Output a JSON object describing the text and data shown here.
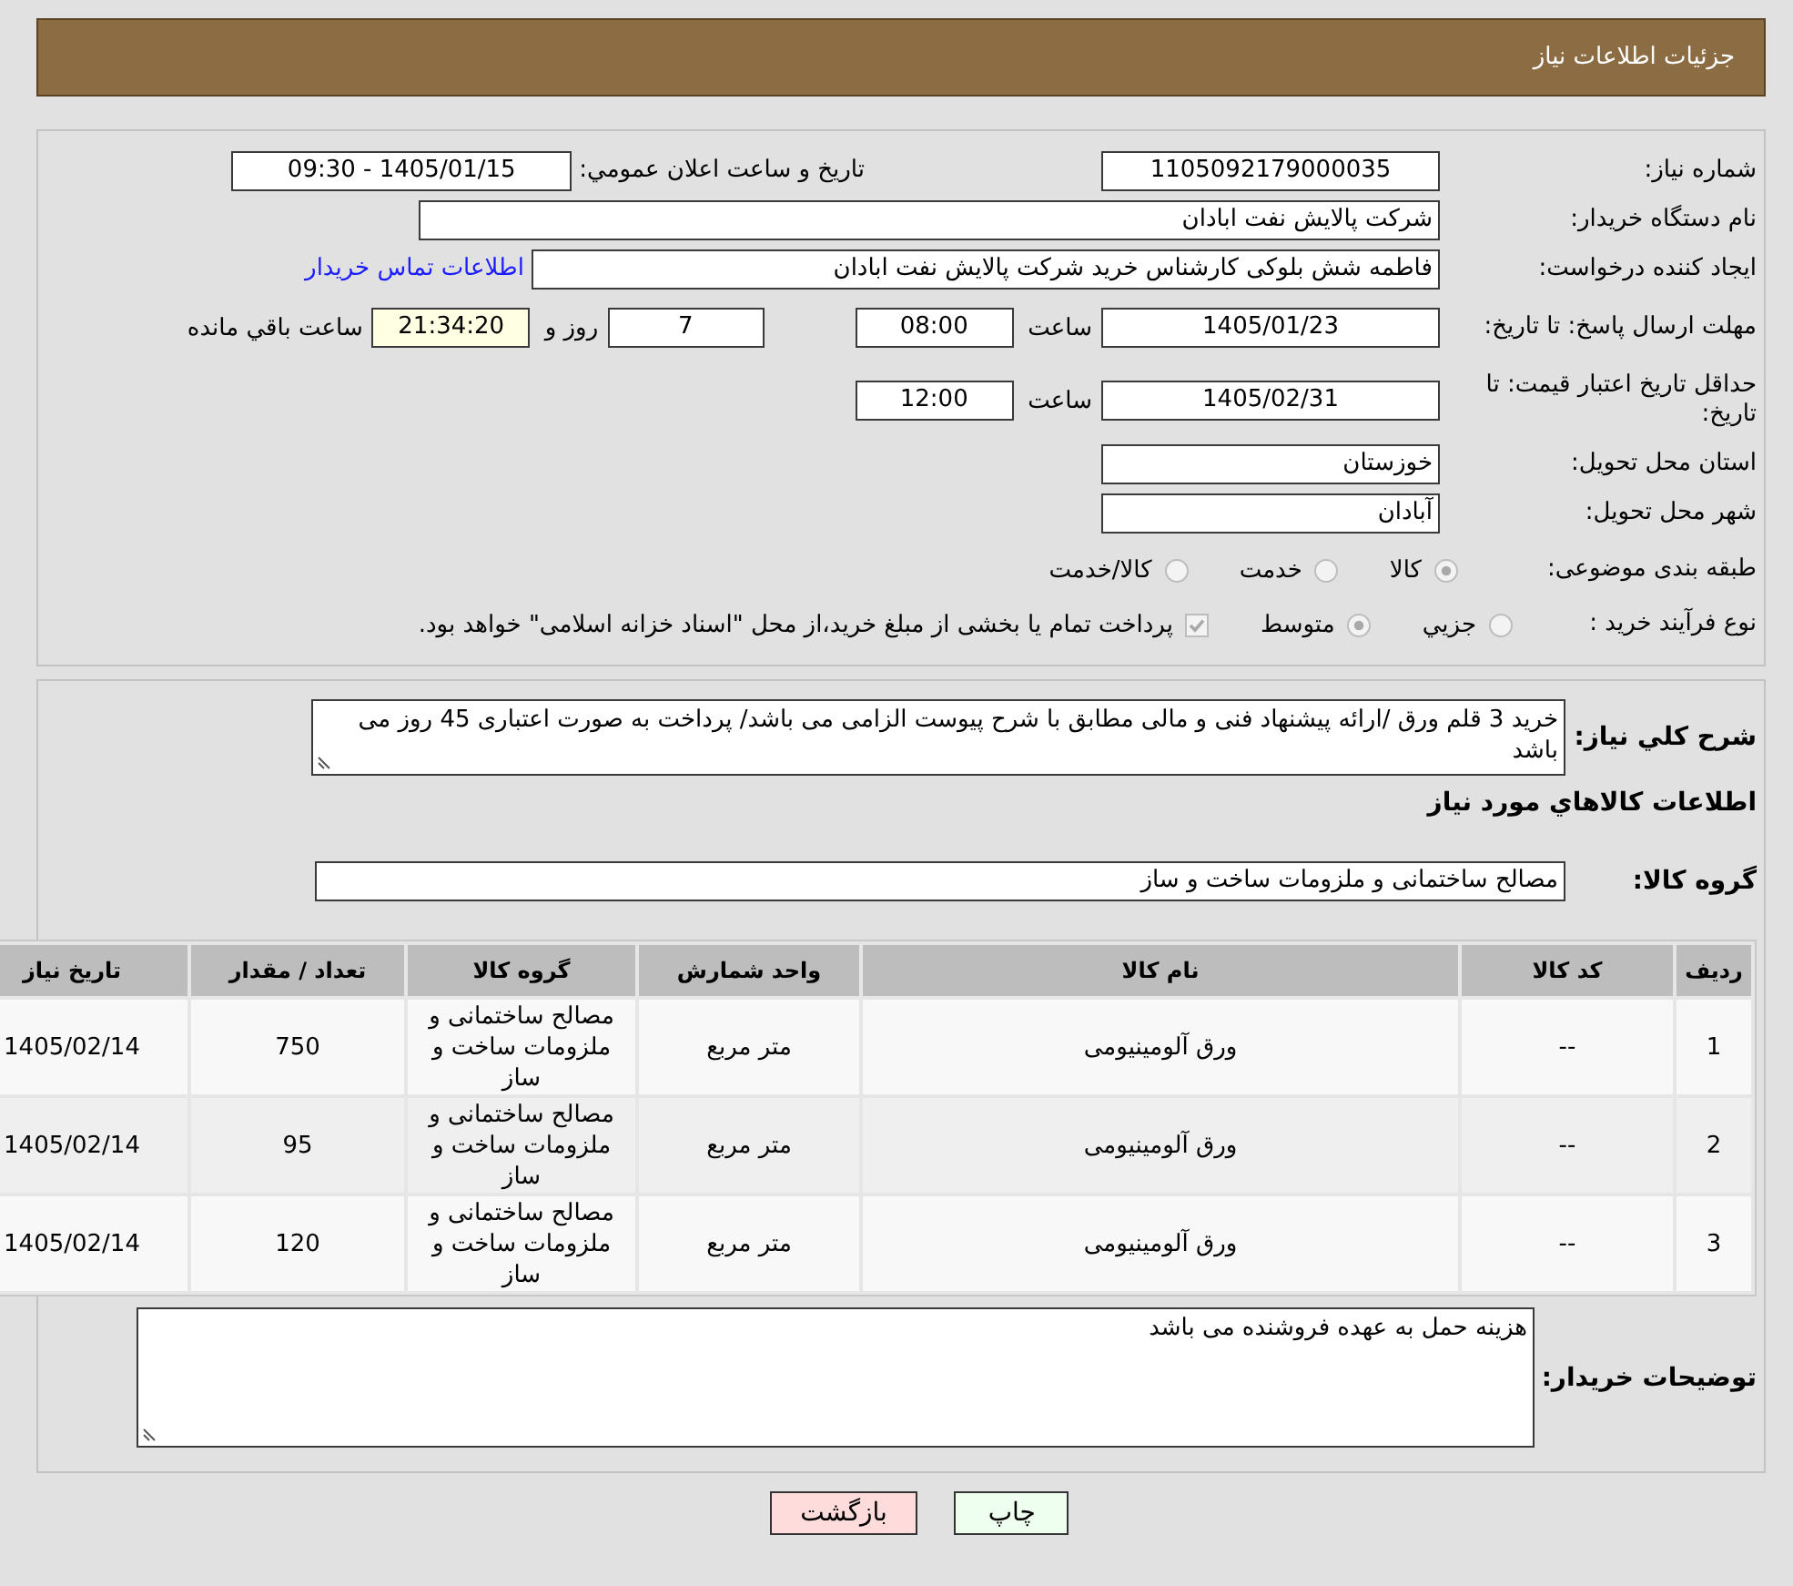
{
  "header": {
    "title": "جزئیات اطلاعات نیاز"
  },
  "form": {
    "need_number": {
      "label": "شماره نیاز:",
      "value": "1105092179000035"
    },
    "announcement": {
      "label": "تاریخ و ساعت اعلان عمومي:",
      "value": "1405/01/15 - 09:30"
    },
    "buyer_org": {
      "label": "نام دستگاه خریدار:",
      "value": "شرکت پالایش نفت ابادان"
    },
    "requester": {
      "label": "ایجاد کننده درخواست:",
      "value": "فاطمه شش بلوکی کارشناس خرید شرکت پالایش نفت ابادان",
      "link": "اطلاعات تماس خریدار"
    },
    "response_deadline": {
      "label": "مهلت ارسال پاسخ: تا تاریخ:",
      "date": "1405/01/23",
      "time_label": "ساعت",
      "time": "08:00",
      "days": "7",
      "days_label": "روز و",
      "remaining": "21:34:20",
      "remaining_label": "ساعت باقي مانده"
    },
    "price_validity": {
      "label": "حداقل تاریخ اعتبار قیمت: تا تاریخ:",
      "date": "1405/02/31",
      "time_label": "ساعت",
      "time": "12:00"
    },
    "province": {
      "label": "استان محل تحویل:",
      "value": "خوزستان"
    },
    "city": {
      "label": "شهر محل تحویل:",
      "value": "آبادان"
    },
    "category": {
      "label": "طبقه بندی موضوعی:",
      "disabled": true,
      "options": [
        {
          "label": "کالا",
          "selected": true
        },
        {
          "label": "خدمت",
          "selected": false
        },
        {
          "label": "کالا/خدمت",
          "selected": false
        }
      ]
    },
    "process": {
      "label": "نوع فرآیند خرید :",
      "disabled": true,
      "options": [
        {
          "label": "جزيي",
          "selected": false
        },
        {
          "label": "متوسط",
          "selected": true
        }
      ],
      "treasury": {
        "label": "پرداخت تمام یا بخشی از مبلغ خرید،از محل \"اسناد خزانه اسلامی\" خواهد بود.",
        "checked": true,
        "disabled": true
      }
    }
  },
  "description": {
    "label": "شرح کلي نیاز:",
    "value": "خرید 3 قلم ورق /ارائه پیشنهاد فنی و مالی مطابق با شرح پیوست الزامی می باشد/ پرداخت به صورت اعتباری 45 روز می باشد"
  },
  "goods": {
    "title": "اطلاعات کالاهاي مورد نیاز",
    "group": {
      "label": "گروه کالا:",
      "value": "مصالح ساختمانی و ملزومات ساخت و ساز"
    },
    "table": {
      "columns": [
        "ردیف",
        "کد کالا",
        "نام کالا",
        "واحد شمارش",
        "گروه کالا",
        "تعداد / مقدار",
        "تاریخ نیاز"
      ],
      "rows": [
        [
          "1",
          "--",
          "ورق آلومینیومی",
          "متر مربع",
          "مصالح ساختمانی و ملزومات ساخت و ساز",
          "750",
          "1405/02/14"
        ],
        [
          "2",
          "--",
          "ورق آلومینیومی",
          "متر مربع",
          "مصالح ساختمانی و ملزومات ساخت و ساز",
          "95",
          "1405/02/14"
        ],
        [
          "3",
          "--",
          "ورق آلومینیومی",
          "متر مربع",
          "مصالح ساختمانی و ملزومات ساخت و ساز",
          "120",
          "1405/02/14"
        ]
      ]
    }
  },
  "buyer_notes": {
    "label": "توضیحات خریدار:",
    "value": "هزینه حمل به عهده فروشنده می باشد"
  },
  "buttons": [
    {
      "label": "چاپ",
      "kind": "print"
    },
    {
      "label": "بازگشت",
      "kind": "back"
    }
  ]
}
